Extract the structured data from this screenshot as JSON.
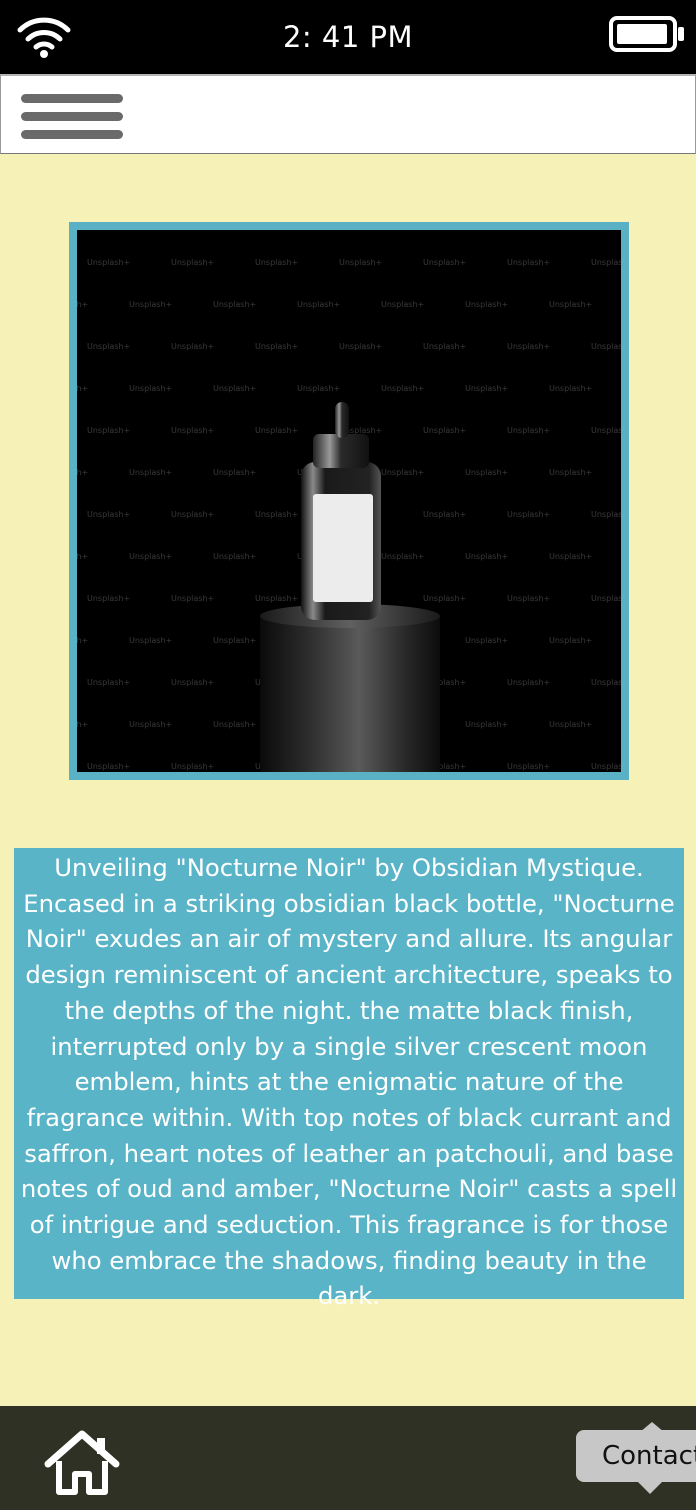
{
  "status_bar": {
    "time": "2: 41 PM",
    "wifi_icon": "wifi-icon",
    "battery_icon": "battery-icon"
  },
  "nav": {
    "menu_icon": "hamburger-menu-icon"
  },
  "product": {
    "image_description_icon": "perfume-bottle-image",
    "watermark_text": "Unsplash+",
    "frame_color": "#5ab1c6"
  },
  "description": {
    "text": "Unveiling \"Nocturne Noir\" by Obsidian Mystique. Encased in a striking obsidian black bottle, \"Nocturne Noir\" exudes an air of mystery and allure. Its angular design reminiscent of ancient architecture, speaks to the depths of the night. the matte black finish, interrupted only by a single silver crescent moon emblem, hints at the enigmatic nature of the fragrance within. With top notes of black currant and saffron, heart notes of leather an patchouli, and base notes of oud and amber, \"Nocturne Noir\" casts a spell of intrigue and seduction. This fragrance is for those who embrace the shadows, finding beauty in the dark.",
    "background_color": "#5ab4c7"
  },
  "bottom_bar": {
    "home_icon": "home-icon",
    "contact_label": "Contact"
  },
  "colors": {
    "page_background": "#f6f1b7",
    "bottom_bar": "#2f3124",
    "status_bar": "#000000"
  }
}
